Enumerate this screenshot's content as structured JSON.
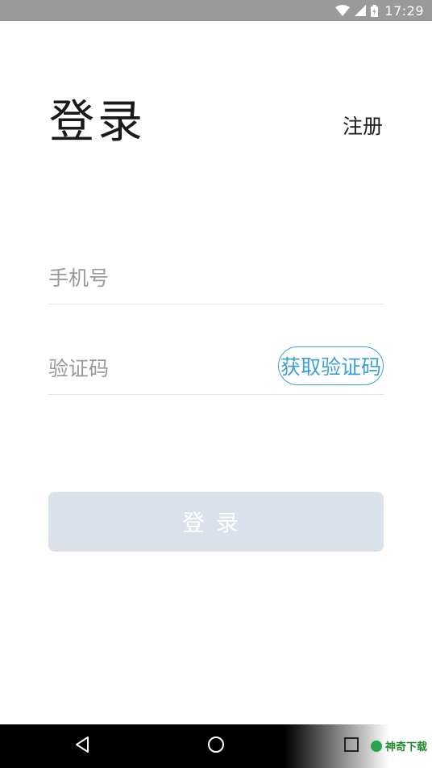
{
  "status_bar": {
    "time": "17:29",
    "icons": [
      "wifi-icon",
      "signal-icon",
      "battery-icon"
    ]
  },
  "header": {
    "title": "登录",
    "register_label": "注册"
  },
  "form": {
    "phone_placeholder": "手机号",
    "phone_value": "",
    "code_placeholder": "验证码",
    "code_value": "",
    "get_code_label": "获取验证码"
  },
  "login_button": {
    "label": "登录",
    "disabled": true
  },
  "colors": {
    "accent": "#3ba0d8",
    "login_disabled_bg": "#dbe1ea",
    "status_bar_bg": "#9a9a9a"
  },
  "nav_bar": {
    "buttons": [
      "back-icon",
      "home-icon",
      "recent-apps-icon"
    ],
    "watermark_text": "神奇下载"
  }
}
